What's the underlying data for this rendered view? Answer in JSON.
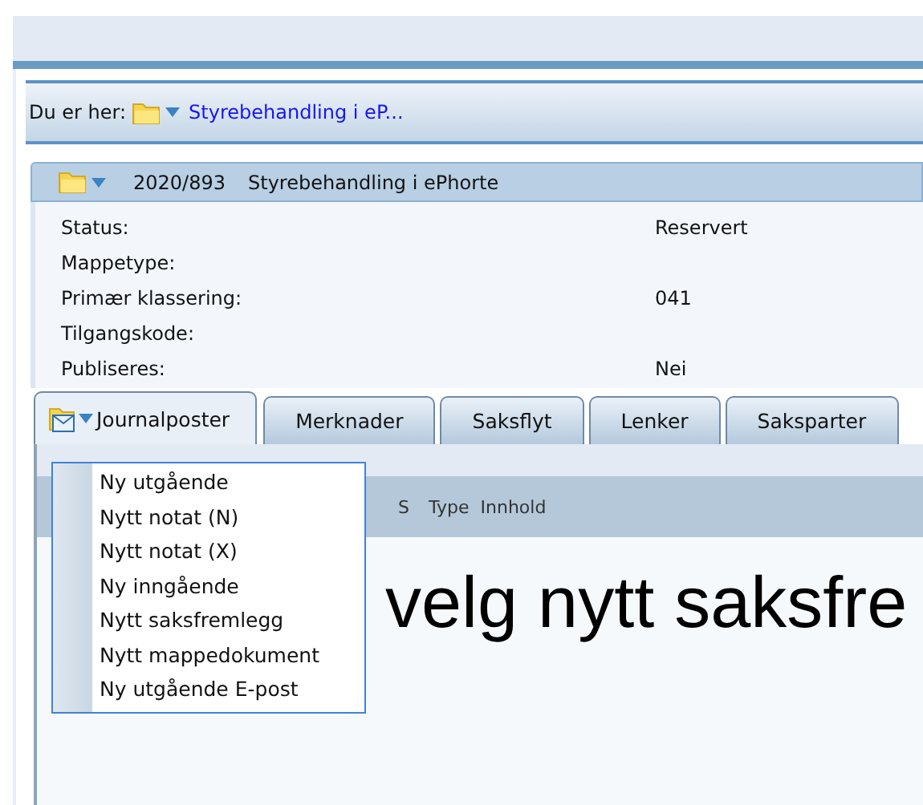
{
  "breadcrumb": {
    "label": "Du er her:",
    "link": "Styrebehandling i eP..."
  },
  "case": {
    "number": "2020/893",
    "title": "Styrebehandling i ePhorte"
  },
  "details": [
    {
      "label": "Status:",
      "value": "Reservert"
    },
    {
      "label": "Mappetype:"
    },
    {
      "label": "Primær klassering:",
      "value": "041"
    },
    {
      "label": "Tilgangskode:"
    },
    {
      "label": "Publiseres:",
      "value": "Nei"
    }
  ],
  "tabs": [
    {
      "label": "Journalposter",
      "selected": true
    },
    {
      "label": "Merknader",
      "selected": false
    },
    {
      "label": "Saksflyt",
      "selected": false
    },
    {
      "label": "Lenker",
      "selected": false
    },
    {
      "label": "Saksparter",
      "selected": false
    }
  ],
  "table": {
    "columns": [
      "S",
      "Type",
      "Innhold"
    ]
  },
  "menu": {
    "items": [
      "Ny utgående",
      "Nytt notat (N)",
      "Nytt notat (X)",
      "Ny inngående",
      "Nytt saksfremlegg",
      "Nytt mappedokument",
      "Ny utgående E-post"
    ]
  },
  "annotation": "velg nytt saksfre"
}
